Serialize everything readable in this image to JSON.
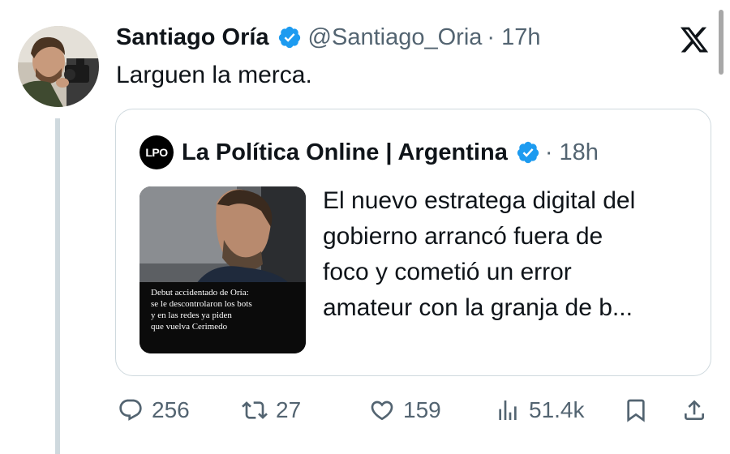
{
  "tweet": {
    "author_name": "Santiago Oría",
    "handle": "@Santiago_Oria",
    "time": "· 17h",
    "text": "Larguen la merca."
  },
  "quoted_tweet": {
    "logo_text": "LPO",
    "author_name": "La Política Online | Argentina",
    "time": "· 18h",
    "text_lines": [
      "El nuevo estratega digital del",
      "gobierno arrancó fuera de",
      "foco y cometió un error",
      "amateur con la granja de b..."
    ],
    "image_caption_lines": [
      "Debut accidentado de Oría:",
      "se le descontrolaron los bots",
      "y en las redes ya piden",
      "que vuelva Cerimedo"
    ]
  },
  "actions": {
    "replies": "256",
    "retweets": "27",
    "likes": "159",
    "views": "51.4k"
  },
  "icons": {
    "reply": "reply-icon",
    "retweet": "retweet-icon",
    "like": "heart-icon",
    "views": "views-icon",
    "bookmark": "bookmark-icon",
    "share": "share-icon",
    "verified": "verified-badge-icon",
    "platform": "x-logo-icon"
  },
  "colors": {
    "verified": "#1d9bf0",
    "muted": "#536471",
    "text": "#0f1419",
    "border": "#cfd9de"
  }
}
